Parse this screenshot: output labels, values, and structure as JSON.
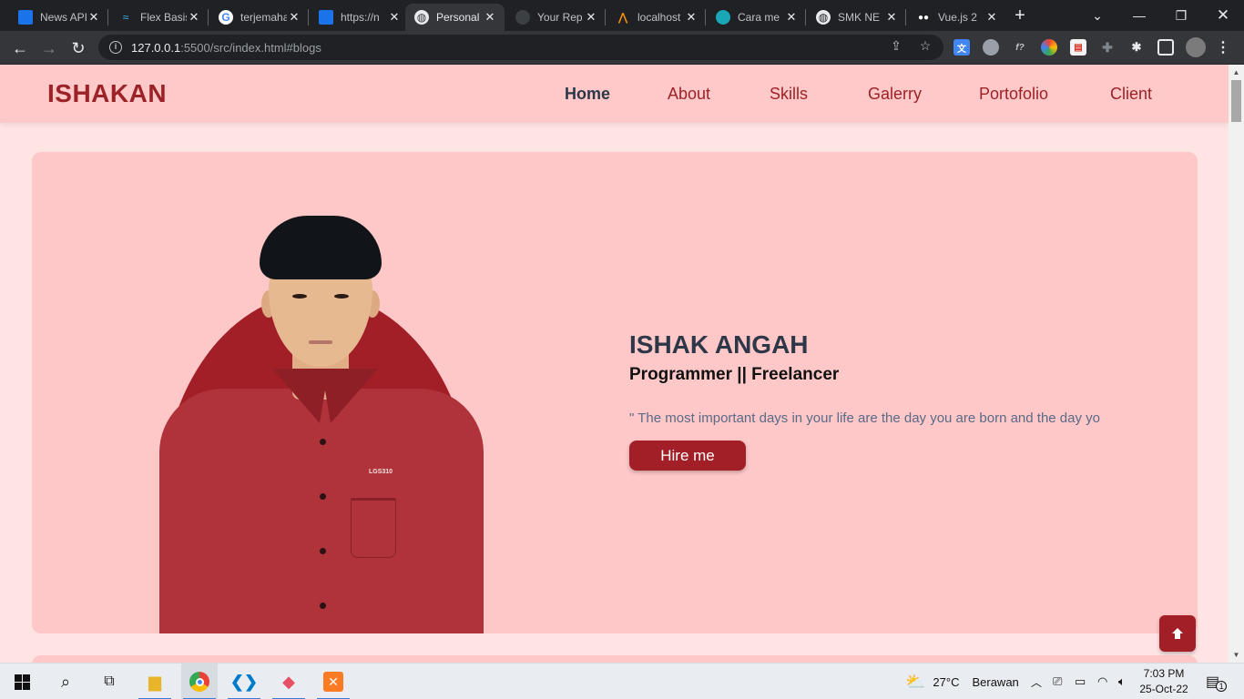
{
  "browser": {
    "tabs": [
      {
        "title": "News API",
        "icon": "blue-doc-icon",
        "active": false
      },
      {
        "title": "Flex Basis",
        "icon": "tailwind-icon",
        "active": false
      },
      {
        "title": "terjemahan",
        "icon": "google-icon",
        "active": false
      },
      {
        "title": "https://n",
        "icon": "blue-doc-icon",
        "active": false
      },
      {
        "title": "Personal",
        "icon": "globe-icon",
        "active": true
      },
      {
        "title": "Your Rep",
        "icon": "github-icon",
        "active": false
      },
      {
        "title": "localhost",
        "icon": "phpmyadmin-icon",
        "active": false
      },
      {
        "title": "Cara me",
        "icon": "site-icon",
        "active": false
      },
      {
        "title": "SMK NE",
        "icon": "globe-icon",
        "active": false
      },
      {
        "title": "Vue.js 2",
        "icon": "medium-icon",
        "active": false
      }
    ],
    "url_host": "127.0.0.1",
    "url_path": ":5500/src/index.html#blogs"
  },
  "site": {
    "brand": "ISHAKAN",
    "nav": [
      "Home",
      "About",
      "Skills",
      "Galerry",
      "Portofolio",
      "Client"
    ],
    "hero": {
      "name": "ISHAK ANGAH",
      "role": "Programmer || Freelancer",
      "quote": "\" The most important days in your life are the day you are born and the day yo",
      "cta": "Hire me",
      "photo_logo": "LGS310"
    }
  },
  "taskbar": {
    "weather_temp": "27°C",
    "weather_text": "Berawan",
    "time": "7:03 PM",
    "date": "25-Oct-22",
    "notification_count": "1"
  },
  "colors": {
    "brand": "#9b2226",
    "accent": "#a31f27",
    "header_bg": "#ffc9c9",
    "page_bg": "#ffe4e4"
  }
}
